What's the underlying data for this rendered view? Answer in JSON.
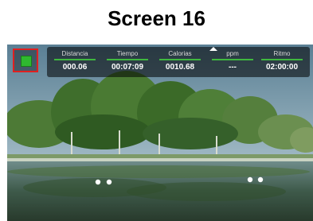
{
  "page": {
    "title": "Screen 16"
  },
  "colors": {
    "accent_green": "#3fb83f",
    "highlight_red": "#e02020"
  },
  "menu_button": {
    "icon": "menu-square-icon"
  },
  "metrics": [
    {
      "label": "Distancia",
      "value": "000.06"
    },
    {
      "label": "Tiempo",
      "value": "00:07:09"
    },
    {
      "label": "Calorias",
      "value": "0010.68"
    },
    {
      "label": "ppm",
      "value": "---"
    },
    {
      "label": "Ritmo",
      "value": "02:00:00"
    }
  ]
}
